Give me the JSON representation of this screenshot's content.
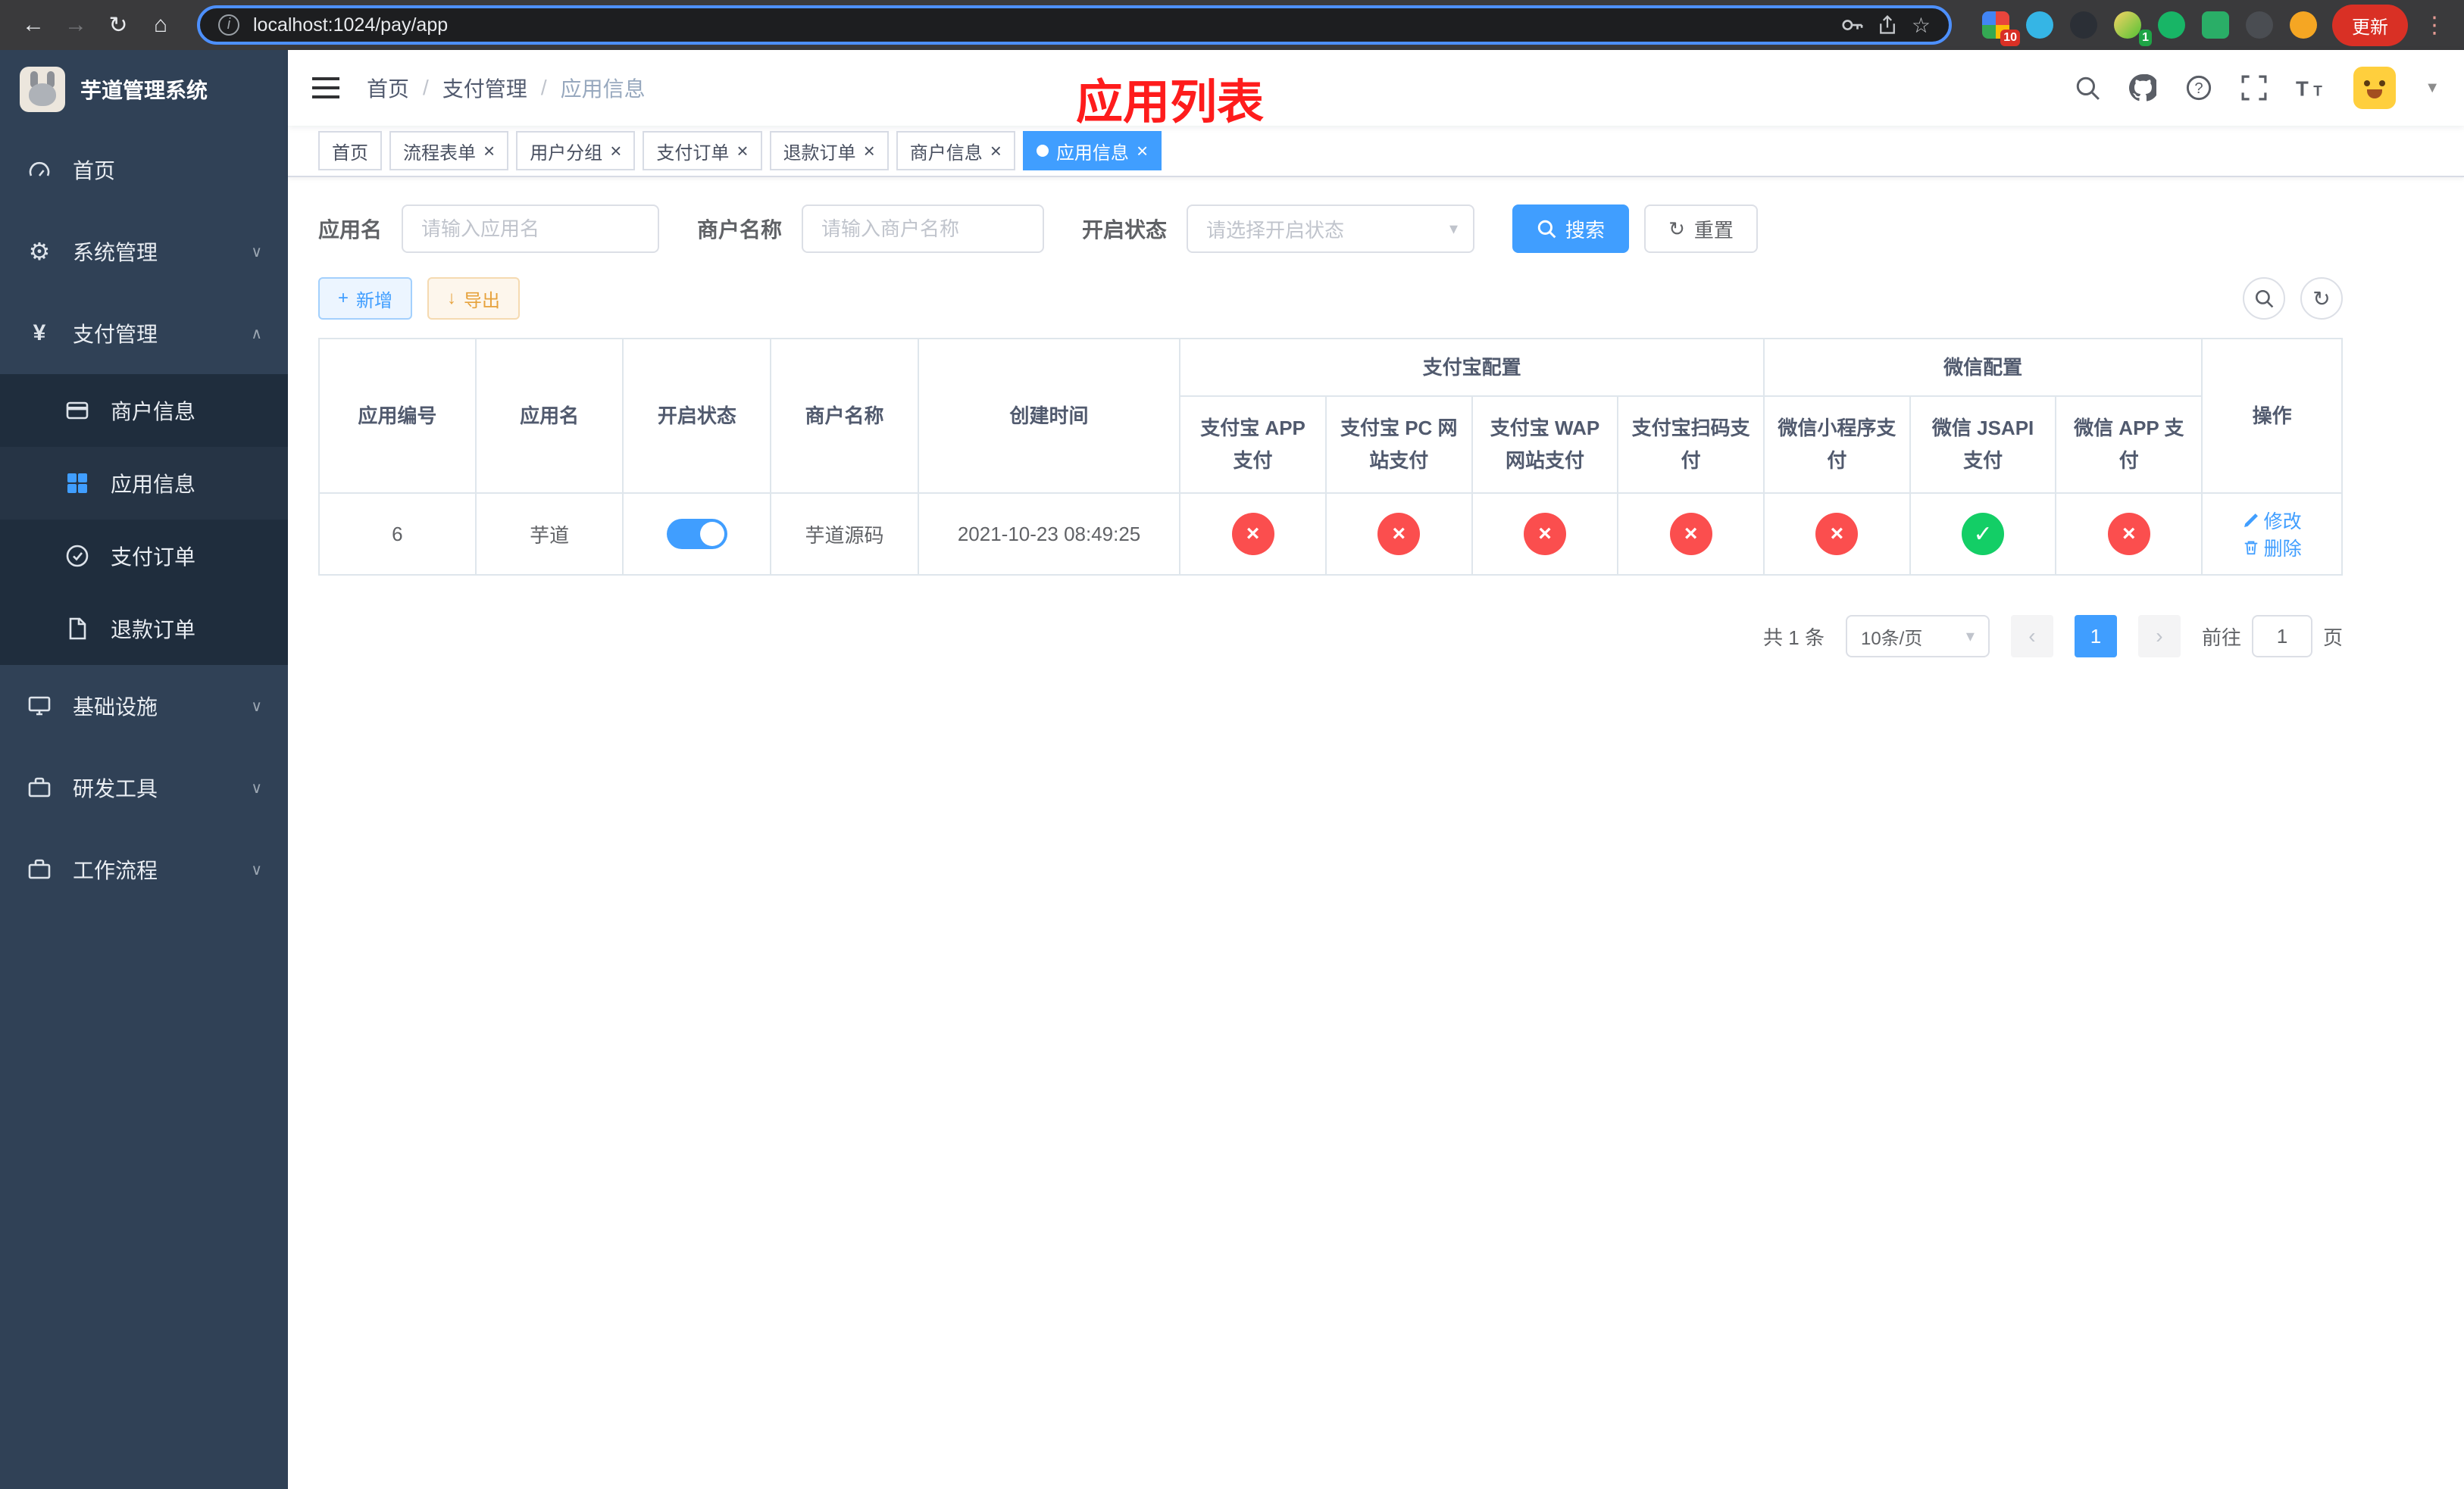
{
  "colors": {
    "primary": "#409eff",
    "success_circle": "#13ce66",
    "danger_circle": "#fb4e4e",
    "warning": "#e6a23c",
    "annotation_red": "#fe1c1c",
    "sidebar_bg": "#304156",
    "submenu_bg": "#1f2d3d"
  },
  "browser": {
    "url": "localhost:1024/pay/app",
    "update_button": "更新",
    "extension_badge_10": "10",
    "extension_badge_1": "1"
  },
  "annotation_title": "应用列表",
  "sidebar": {
    "app_title": "芋道管理系统",
    "items": [
      {
        "label": "首页"
      },
      {
        "label": "系统管理"
      },
      {
        "label": "支付管理"
      },
      {
        "label": "商户信息"
      },
      {
        "label": "应用信息"
      },
      {
        "label": "支付订单"
      },
      {
        "label": "退款订单"
      },
      {
        "label": "基础设施"
      },
      {
        "label": "研发工具"
      },
      {
        "label": "工作流程"
      }
    ]
  },
  "header": {
    "breadcrumb": [
      "首页",
      "支付管理",
      "应用信息"
    ]
  },
  "tabs": [
    {
      "label": "首页"
    },
    {
      "label": "流程表单"
    },
    {
      "label": "用户分组"
    },
    {
      "label": "支付订单"
    },
    {
      "label": "退款订单"
    },
    {
      "label": "商户信息"
    },
    {
      "label": "应用信息"
    }
  ],
  "filters": {
    "app_name_label": "应用名",
    "app_name_placeholder": "请输入应用名",
    "merchant_label": "商户名称",
    "merchant_placeholder": "请输入商户名称",
    "status_label": "开启状态",
    "status_placeholder": "请选择开启状态",
    "search_button": "搜索",
    "reset_button": "重置"
  },
  "toolbar": {
    "add_button": "新增",
    "export_button": "导出"
  },
  "table": {
    "col_app_id": "应用编号",
    "col_app_name": "应用名",
    "col_status": "开启状态",
    "col_merchant": "商户名称",
    "col_create_time": "创建时间",
    "group_alipay": "支付宝配置",
    "group_wechat": "微信配置",
    "col_actions": "操作",
    "sub_cols": [
      "支付宝 APP 支付",
      "支付宝 PC 网站支付",
      "支付宝 WAP 网站支付",
      "支付宝扫码支付",
      "微信小程序支付",
      "微信 JSAPI 支付",
      "微信 APP 支付"
    ],
    "row": {
      "app_id": "6",
      "app_name": "芋道",
      "status_on": true,
      "merchant": "芋道源码",
      "create_time": "2021-10-23 08:49:25",
      "configs": [
        "no",
        "no",
        "no",
        "no",
        "no",
        "yes",
        "no"
      ],
      "edit_label": "修改",
      "delete_label": "删除"
    }
  },
  "pagination": {
    "total": "共 1 条",
    "page_size": "10条/页",
    "current_page": "1",
    "goto_label": "前往",
    "goto_value": "1",
    "page_unit": "页"
  }
}
